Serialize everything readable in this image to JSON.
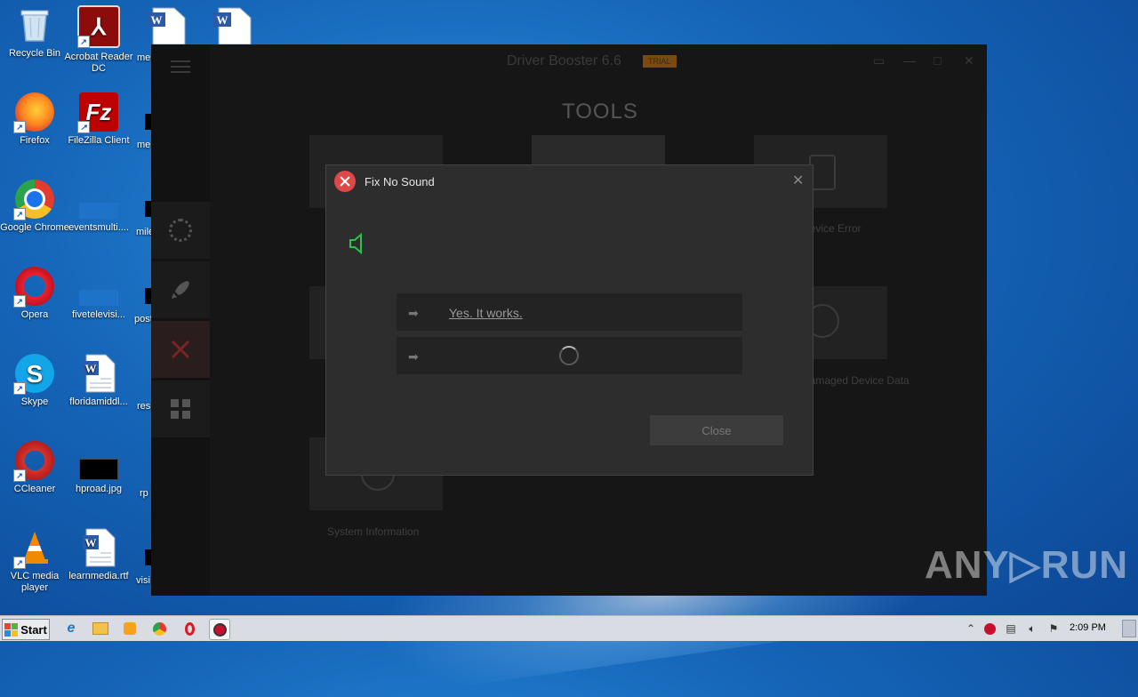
{
  "desktop": {
    "icons": [
      {
        "label": "Recycle Bin"
      },
      {
        "label": "Acrobat Reader DC"
      },
      {
        "label": "Firefox"
      },
      {
        "label": "FileZilla Client"
      },
      {
        "label": "Google Chrome"
      },
      {
        "label": "eventsmulti...."
      },
      {
        "label": "Opera"
      },
      {
        "label": "fivetelevisi..."
      },
      {
        "label": "Skype"
      },
      {
        "label": "floridamiddl..."
      },
      {
        "label": "CCleaner"
      },
      {
        "label": "hproad.jpg"
      },
      {
        "label": "VLC media player"
      },
      {
        "label": "learnmedia.rtf"
      }
    ],
    "partial_labels": [
      "me",
      "me",
      "mile",
      "post",
      "res",
      "rp",
      "visi"
    ]
  },
  "app": {
    "title": "Driver Booster 6.6",
    "badge": "TRIAL",
    "section_title": "TOOLS",
    "tile_labels": [
      "Device Error",
      "Damaged Device Data",
      "System Information"
    ]
  },
  "dialog": {
    "title": "Fix No Sound",
    "option_yes": "Yes. It works.",
    "close_label": "Close"
  },
  "watermark": "ANY▷RUN",
  "taskbar": {
    "start_label": "Start",
    "clock": "2:09 PM"
  },
  "colors": {
    "dialog_bg": "#2d2d2d",
    "speaker_green": "#2fbf4a",
    "accent_red": "#e04848"
  }
}
